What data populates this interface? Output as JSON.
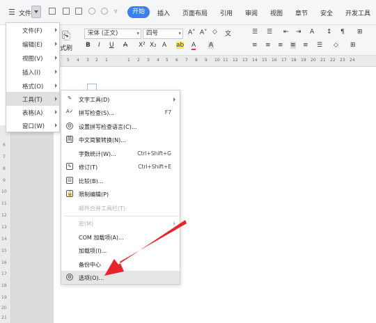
{
  "menubar": {
    "file": "文件",
    "start": "开始",
    "insert": "插入",
    "layout": "页面布局",
    "references": "引用",
    "review": "审阅",
    "view": "视图",
    "sections": "章节",
    "security": "安全",
    "developer": "开发工具"
  },
  "ribbon": {
    "format_brush_fragment": "式刷",
    "font_name": "宋体 (正文)",
    "font_size": "四号"
  },
  "ruler_numbers": [
    "5",
    "4",
    "3",
    "2",
    "1",
    "1",
    "2",
    "3",
    "4",
    "5",
    "6",
    "7",
    "8",
    "9",
    "10",
    "11",
    "12",
    "13",
    "14",
    "15",
    "16",
    "17",
    "18",
    "19",
    "20",
    "21",
    "22",
    "23",
    "24"
  ],
  "vruler_numbers": [
    "6",
    "7",
    "8",
    "9",
    "10",
    "11",
    "12",
    "13",
    "14",
    "15",
    "16",
    "17",
    "18",
    "19",
    "20",
    "21"
  ],
  "app_menu": [
    {
      "label": "文件(F)"
    },
    {
      "label": "编辑(E)"
    },
    {
      "label": "视图(V)"
    },
    {
      "label": "插入(I)"
    },
    {
      "label": "格式(O)"
    },
    {
      "label": "工具(T)",
      "selected": true
    },
    {
      "label": "表格(A)"
    },
    {
      "label": "窗口(W)"
    }
  ],
  "tools_menu": [
    {
      "label": "文字工具(D)",
      "icon": "text-tool-icon",
      "submenu": true
    },
    {
      "label": "拼写检查(S)...",
      "icon": "spell-check-icon",
      "shortcut": "F7"
    },
    {
      "label": "设置拼写检查语言(C)...",
      "icon": "language-icon"
    },
    {
      "label": "中文简繁转换(N)...",
      "icon": "convert-icon"
    },
    {
      "label": "字数统计(W)...",
      "icon": "",
      "shortcut": "Ctrl+Shift+G"
    },
    {
      "label": "修订(T)",
      "icon": "revision-icon",
      "shortcut": "Ctrl+Shift+E"
    },
    {
      "label": "比较(B)...",
      "icon": "compare-icon"
    },
    {
      "label": "限制编辑(P)",
      "icon": "restrict-edit-icon"
    },
    {
      "label": "邮件合并工具栏(T)",
      "icon": "",
      "disabled": true
    },
    {
      "label": "宏(M)",
      "icon": "",
      "disabled": true,
      "submenu": true
    },
    {
      "label": "COM 加载项(A)...",
      "icon": ""
    },
    {
      "label": "加载项(I)...",
      "icon": ""
    },
    {
      "label": "备份中心",
      "icon": ""
    },
    {
      "label": "选项(O)...",
      "icon": "gear-icon",
      "selected": true
    }
  ],
  "colors": {
    "accent": "#3b7ff2",
    "annotation_arrow": "#e8242a"
  }
}
